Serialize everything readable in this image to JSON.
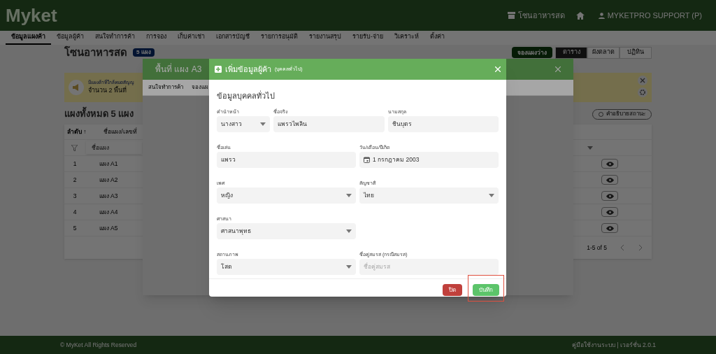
{
  "header": {
    "logo": "Myket",
    "zone": "โซนอาหารสด",
    "user": "MYKETPRO SUPPORT (P)"
  },
  "nav": [
    {
      "label": "ข้อมูลแผงค้า",
      "selected": true
    },
    {
      "label": "ข้อมูลผู้ค้า",
      "selected": false
    },
    {
      "label": "สนใจทำการค้า",
      "selected": false
    },
    {
      "label": "การจอง",
      "selected": false
    },
    {
      "label": "เก็บค่าเช่า",
      "selected": false
    },
    {
      "label": "เอกสารบัญชี",
      "selected": false
    },
    {
      "label": "รายการอนุมัติ",
      "selected": false
    },
    {
      "label": "รายงานสรุป",
      "selected": false
    },
    {
      "label": "รายรับ-จ่าย",
      "selected": false
    },
    {
      "label": "วิเคราะห์",
      "selected": false
    },
    {
      "label": "ตั้งค่า",
      "selected": false
    }
  ],
  "page": {
    "title": "โซนอาหารสด",
    "badge": "5 แผง",
    "action": "จองแผงว่าง",
    "views": [
      {
        "label": "ตาราง",
        "selected": true
      },
      {
        "label": "ผังตลาด",
        "selected": false
      },
      {
        "label": "ปฏิทิน",
        "selected": false
      }
    ],
    "alert": {
      "title": "มีแผงค้าที่ใกล้หมดสัญญ",
      "count": "จำนวน 2 พื้นที่"
    },
    "summary": "แผงทั้งหมด 5 แผง",
    "legend_button": "คำอธิบายสถานะ",
    "table": {
      "columns": [
        "ลำดับ ↑",
        "ชื่อแผง/เลขที่"
      ],
      "filter_placeholder": "ชื่อแผง",
      "rows": [
        {
          "index": "1",
          "name": "แผง A1"
        },
        {
          "index": "2",
          "name": "แผง A2"
        },
        {
          "index": "3",
          "name": "แผง A3"
        },
        {
          "index": "4",
          "name": "แผง A4"
        },
        {
          "index": "5",
          "name": "แผง A5"
        }
      ],
      "pagination": "1-5 of 5"
    }
  },
  "back_dialog": {
    "title": "พื้นที่ แผง A3",
    "tabs": [
      "สนใจทำการค้า",
      "จองแผ"
    ]
  },
  "dialog": {
    "title": "เพิ่มข้อมูลผู้ค้า",
    "subtitle": "(บุคคลทั่วไป)",
    "section": "ข้อมูลบุคคลทั่วไป",
    "rows": [
      [
        {
          "label": "คำนำหน้า",
          "value": "นางสาว",
          "kind": "select"
        },
        {
          "label": "ชื่อจริง",
          "value": "แพรวไพลิน",
          "kind": "text"
        },
        {
          "label": "นามสกุล",
          "value": "ชินบุตร",
          "kind": "text"
        }
      ],
      [
        {
          "label": "ชื่อเล่น",
          "value": "แพรว",
          "kind": "text"
        },
        {
          "label": "วัน/เดือน/ปีเกิด",
          "value": "1 กรกฎาคม 2003",
          "kind": "date"
        }
      ],
      [
        {
          "label": "เพศ",
          "value": "หญิง",
          "kind": "select"
        },
        {
          "label": "สัญชาติ",
          "value": "ไทย",
          "kind": "select"
        }
      ],
      [
        {
          "label": "ศาสนา",
          "value": "ศาสนาพุทธ",
          "kind": "select"
        }
      ],
      [
        {
          "label": "สถานภาพ",
          "value": "โสด",
          "kind": "select"
        },
        {
          "label": "ชื่อคู่สมรส (กรณีสมรส)",
          "placeholder": "ชื่อคู่สมรส",
          "kind": "text"
        }
      ]
    ],
    "buttons": [
      {
        "label": "ปิด",
        "kind": "close",
        "highlighted": false
      },
      {
        "label": "บันทึก",
        "kind": "save",
        "highlighted": true
      }
    ]
  },
  "footer": {
    "copyright": "© MyKet All Rights Reserved",
    "info": "คู่มือใช้งานระบบ | เวอร์ชั่น 2.0.1"
  }
}
